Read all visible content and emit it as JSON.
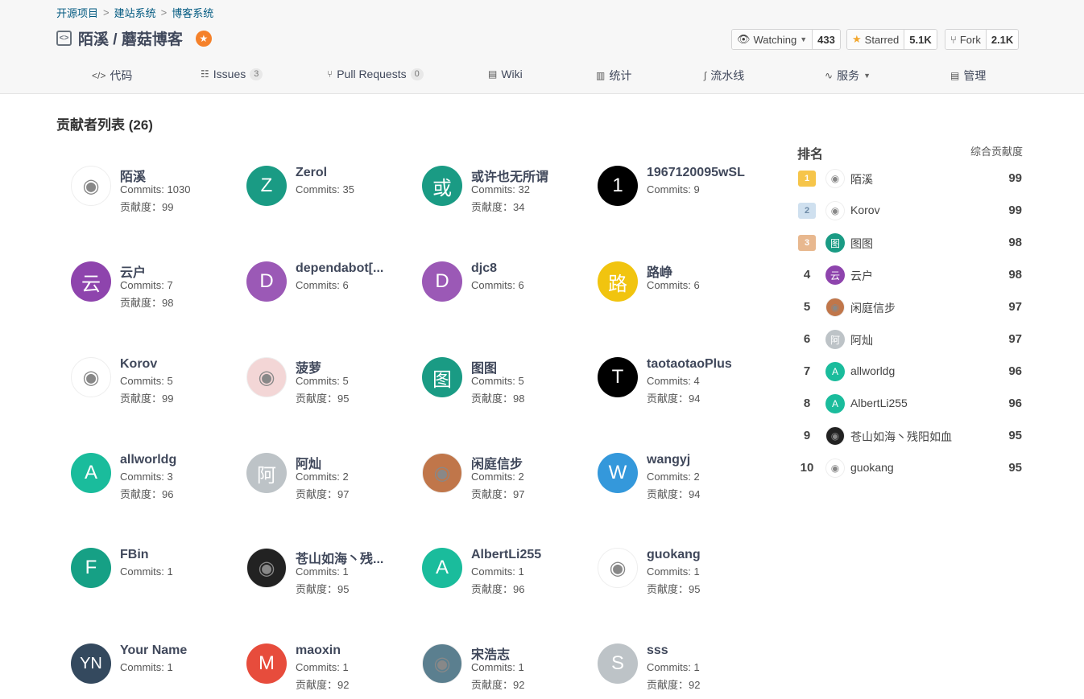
{
  "breadcrumb": [
    "开源项目",
    "建站系统",
    "博客系统"
  ],
  "repo": {
    "title": "陌溪 / 蘑菇博客"
  },
  "actions": {
    "watch": {
      "label": "Watching",
      "count": "433"
    },
    "star": {
      "label": "Starred",
      "count": "5.1K"
    },
    "fork": {
      "label": "Fork",
      "count": "2.1K"
    }
  },
  "tabs": {
    "code": "代码",
    "issues": "Issues",
    "issues_count": "3",
    "pulls": "Pull Requests",
    "pulls_count": "0",
    "wiki": "Wiki",
    "stats": "统计",
    "pipeline": "流水线",
    "services": "服务",
    "manage": "管理"
  },
  "section_title": "贡献者列表 (26)",
  "contributors": [
    {
      "name": "陌溪",
      "commits": "Commits: 1030",
      "score": "贡献度：99",
      "letter": "",
      "color": "#ffffff"
    },
    {
      "name": "Zerol",
      "commits": "Commits: 35",
      "score": "",
      "letter": "Z",
      "color": "#1a9b84"
    },
    {
      "name": "或许也无所谓",
      "commits": "Commits: 32",
      "score": "贡献度：34",
      "letter": "或",
      "color": "#1a9b84"
    },
    {
      "name": "1967120095wSL",
      "commits": "Commits: 9",
      "score": "",
      "letter": "1",
      "color": "#000000"
    },
    {
      "name": "云户",
      "commits": "Commits: 7",
      "score": "贡献度：98",
      "letter": "云",
      "color": "#8e44ad"
    },
    {
      "name": "dependabot[...",
      "commits": "Commits: 6",
      "score": "",
      "letter": "D",
      "color": "#9b59b6"
    },
    {
      "name": "djc8",
      "commits": "Commits: 6",
      "score": "",
      "letter": "D",
      "color": "#9b59b6"
    },
    {
      "name": "路峥",
      "commits": "Commits: 6",
      "score": "",
      "letter": "路",
      "color": "#f1c40f"
    },
    {
      "name": "Korov",
      "commits": "Commits: 5",
      "score": "贡献度：99",
      "letter": "",
      "color": "#ffffff"
    },
    {
      "name": "菠萝",
      "commits": "Commits: 5",
      "score": "贡献度：95",
      "letter": "",
      "color": "#f3d6d6"
    },
    {
      "name": "图图",
      "commits": "Commits: 5",
      "score": "贡献度：98",
      "letter": "图",
      "color": "#1a9b84"
    },
    {
      "name": "taotaotaoPlus",
      "commits": "Commits: 4",
      "score": "贡献度：94",
      "letter": "T",
      "color": "#000000"
    },
    {
      "name": "allworldg",
      "commits": "Commits: 3",
      "score": "贡献度：96",
      "letter": "A",
      "color": "#1abc9c"
    },
    {
      "name": "阿灿",
      "commits": "Commits: 2",
      "score": "贡献度：97",
      "letter": "阿",
      "color": "#bdc3c7"
    },
    {
      "name": "闲庭信步",
      "commits": "Commits: 2",
      "score": "贡献度：97",
      "letter": "",
      "color": "#c0764a"
    },
    {
      "name": "wangyj",
      "commits": "Commits: 2",
      "score": "贡献度：94",
      "letter": "W",
      "color": "#3498db"
    },
    {
      "name": "FBin",
      "commits": "Commits: 1",
      "score": "",
      "letter": "F",
      "color": "#16a085"
    },
    {
      "name": "苍山如海丶残...",
      "commits": "Commits: 1",
      "score": "贡献度：95",
      "letter": "",
      "color": "#222222"
    },
    {
      "name": "AlbertLi255",
      "commits": "Commits: 1",
      "score": "贡献度：96",
      "letter": "A",
      "color": "#1abc9c"
    },
    {
      "name": "guokang",
      "commits": "Commits: 1",
      "score": "贡献度：95",
      "letter": "",
      "color": "#ffffff"
    },
    {
      "name": "Your Name",
      "commits": "Commits: 1",
      "score": "",
      "letter": "YN",
      "color": "#34495e"
    },
    {
      "name": "maoxin",
      "commits": "Commits: 1",
      "score": "贡献度：92",
      "letter": "M",
      "color": "#e74c3c"
    },
    {
      "name": "宋浩志",
      "commits": "Commits: 1",
      "score": "贡献度：92",
      "letter": "",
      "color": "#5b7f8f"
    },
    {
      "name": "sss",
      "commits": "Commits: 1",
      "score": "贡献度：92",
      "letter": "S",
      "color": "#bdc3c7"
    }
  ],
  "ranking": {
    "header_left": "排名",
    "header_right": "综合贡献度",
    "rows": [
      {
        "rank": "1",
        "name": "陌溪",
        "score": "99",
        "letter": "",
        "color": "#ffffff"
      },
      {
        "rank": "2",
        "name": "Korov",
        "score": "99",
        "letter": "",
        "color": "#ffffff"
      },
      {
        "rank": "3",
        "name": "图图",
        "score": "98",
        "letter": "图",
        "color": "#1a9b84"
      },
      {
        "rank": "4",
        "name": "云户",
        "score": "98",
        "letter": "云",
        "color": "#8e44ad"
      },
      {
        "rank": "5",
        "name": "闲庭信步",
        "score": "97",
        "letter": "",
        "color": "#c0764a"
      },
      {
        "rank": "6",
        "name": "阿灿",
        "score": "97",
        "letter": "阿",
        "color": "#bdc3c7"
      },
      {
        "rank": "7",
        "name": "allworldg",
        "score": "96",
        "letter": "A",
        "color": "#1abc9c"
      },
      {
        "rank": "8",
        "name": "AlbertLi255",
        "score": "96",
        "letter": "A",
        "color": "#1abc9c"
      },
      {
        "rank": "9",
        "name": "苍山如海丶残阳如血",
        "score": "95",
        "letter": "",
        "color": "#222222"
      },
      {
        "rank": "10",
        "name": "guokang",
        "score": "95",
        "letter": "",
        "color": "#ffffff"
      }
    ]
  }
}
